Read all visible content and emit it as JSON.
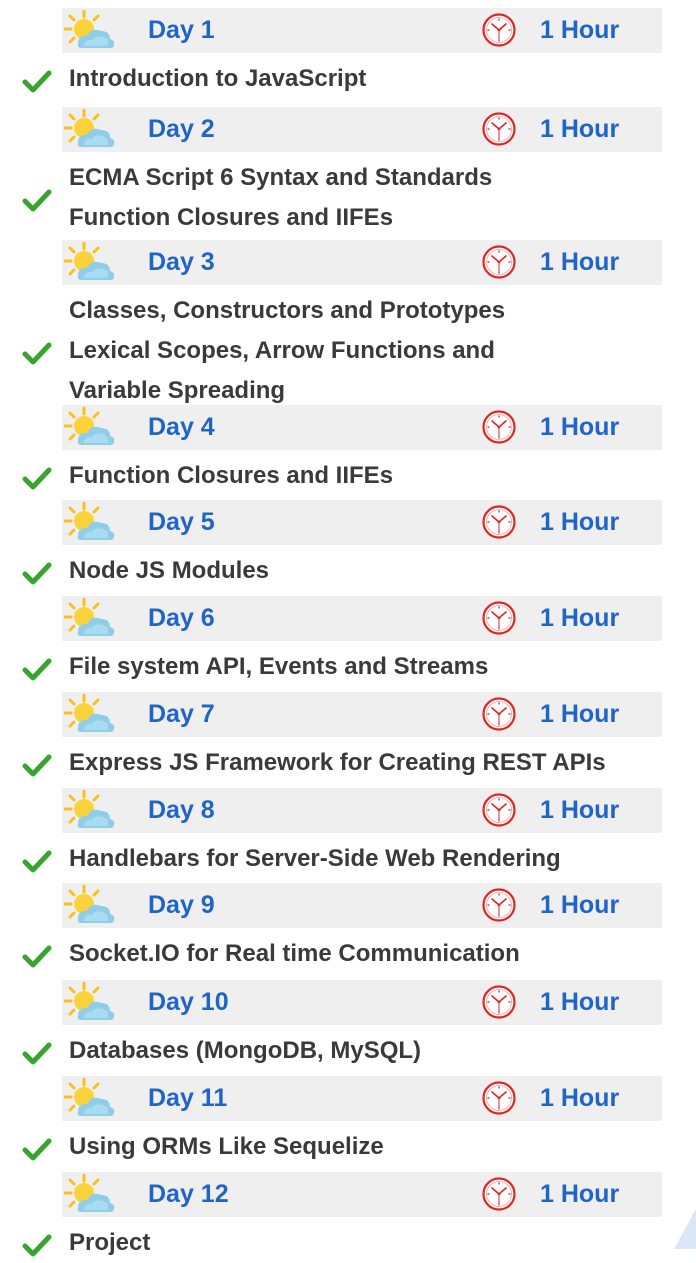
{
  "colors": {
    "accent": "#1f64c8",
    "header_bg": "#efefef",
    "check": "#3aa22e",
    "clock": "#e02525",
    "topic_text": "#3a3a3a"
  },
  "icons": {
    "day": "sun-behind-cloud-icon",
    "duration": "clock-icon",
    "topic": "check-mark-icon"
  },
  "days": [
    {
      "label": "Day 1",
      "duration": "1 Hour",
      "topics": [
        "Introduction to JavaScript"
      ]
    },
    {
      "label": "Day 2",
      "duration": "1 Hour",
      "topics": [
        "ECMA Script 6 Syntax and Standards",
        "Function Closures and IIFEs"
      ]
    },
    {
      "label": "Day 3",
      "duration": "1 Hour",
      "topics": [
        "Classes, Constructors and Prototypes",
        "Lexical Scopes, Arrow Functions and",
        "Variable Spreading"
      ]
    },
    {
      "label": "Day 4",
      "duration": "1 Hour",
      "topics": [
        "Function Closures and IIFEs"
      ]
    },
    {
      "label": "Day 5",
      "duration": "1 Hour",
      "topics": [
        "Node JS Modules"
      ]
    },
    {
      "label": "Day 6",
      "duration": "1 Hour",
      "topics": [
        "File system API, Events and Streams"
      ]
    },
    {
      "label": "Day 7",
      "duration": "1 Hour",
      "topics": [
        "Express JS Framework for Creating REST APIs"
      ]
    },
    {
      "label": "Day 8",
      "duration": "1 Hour",
      "topics": [
        "Handlebars for Server-Side Web Rendering"
      ]
    },
    {
      "label": "Day 9",
      "duration": "1 Hour",
      "topics": [
        "Socket.IO for Real time Communication"
      ]
    },
    {
      "label": "Day 10",
      "duration": "1 Hour",
      "topics": [
        "Databases (MongoDB, MySQL)"
      ]
    },
    {
      "label": "Day 11",
      "duration": "1 Hour",
      "topics": [
        "Using ORMs Like Sequelize"
      ]
    },
    {
      "label": "Day 12",
      "duration": "1 Hour",
      "topics": [
        "Project"
      ]
    }
  ]
}
